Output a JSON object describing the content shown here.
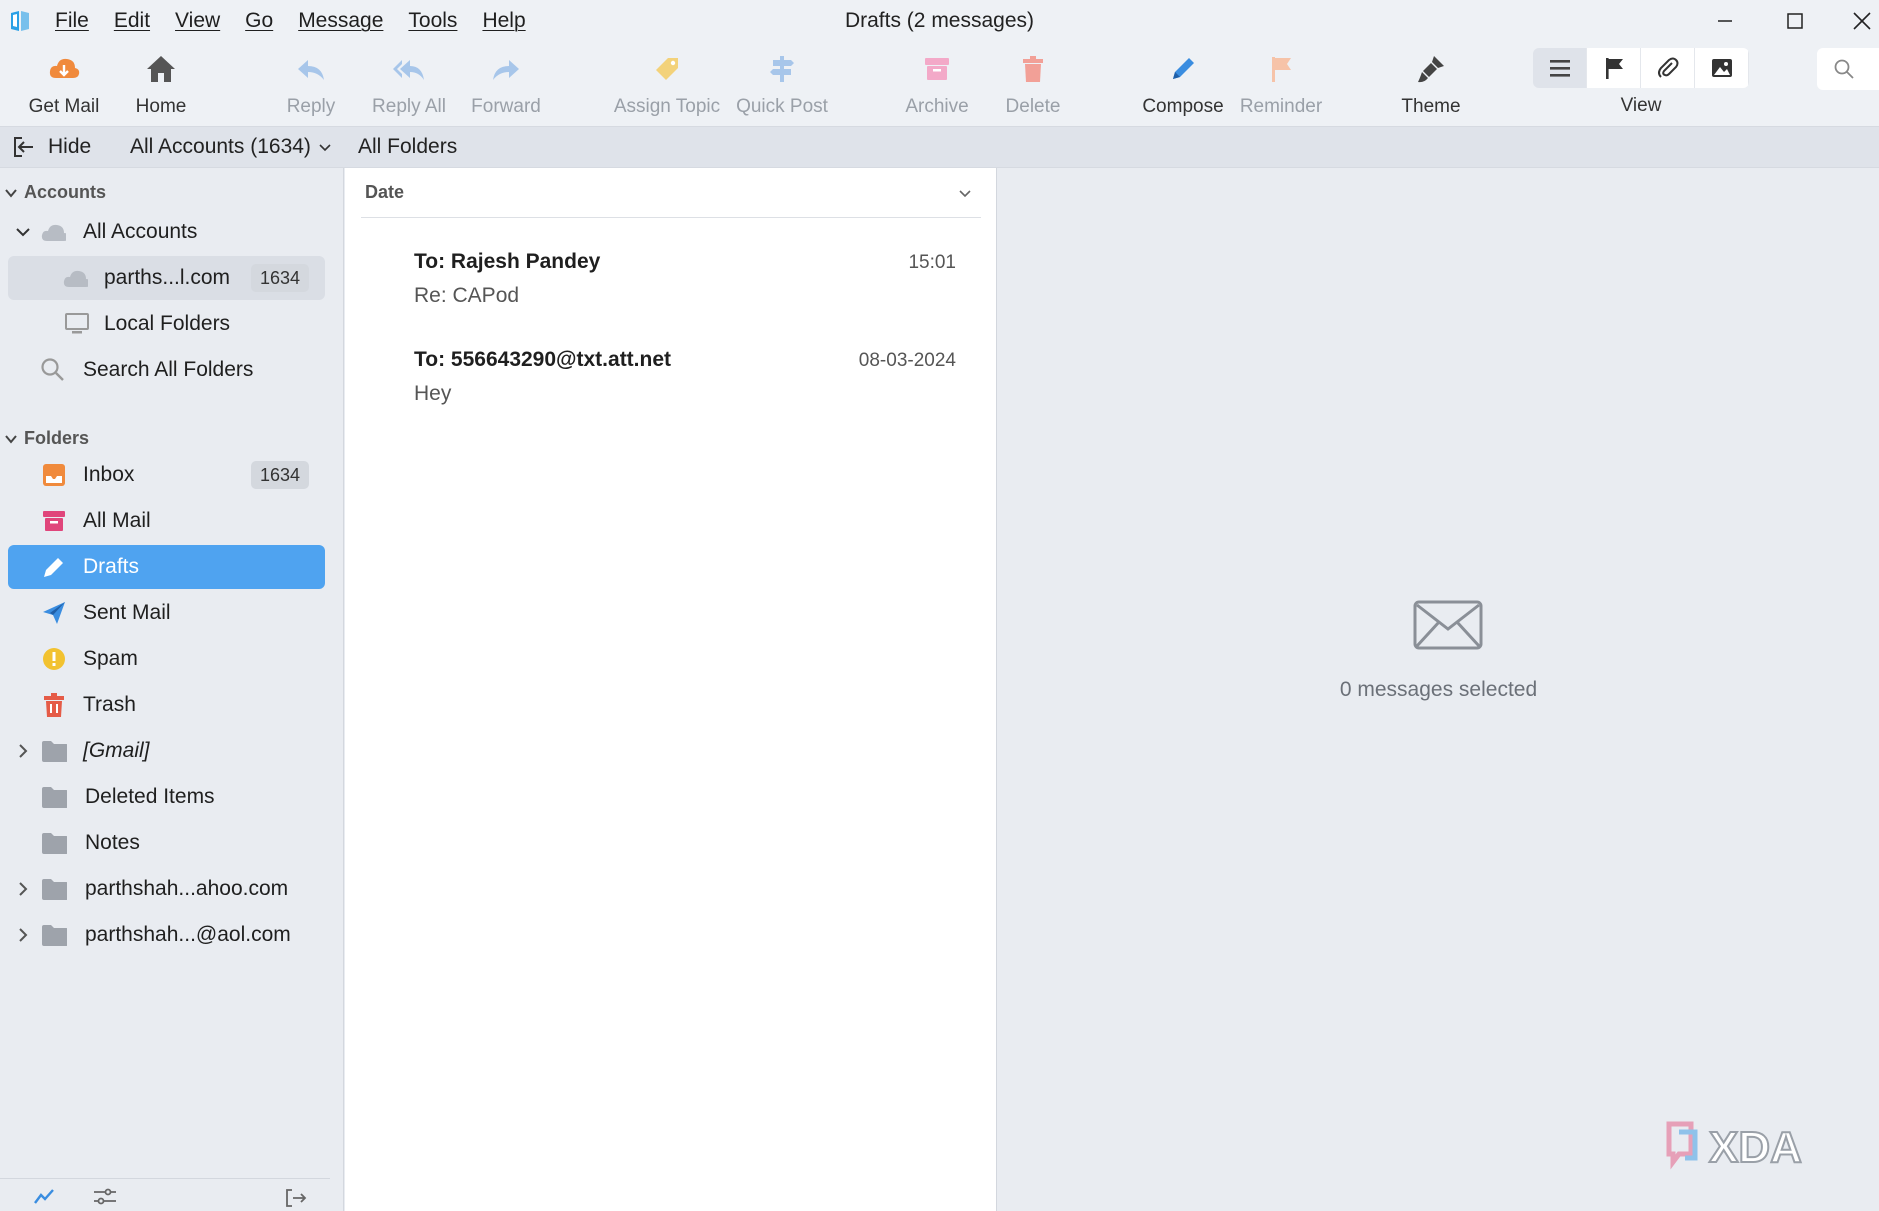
{
  "window": {
    "title": "Drafts (2 messages)"
  },
  "menu": [
    "File",
    "Edit",
    "View",
    "Go",
    "Message",
    "Tools",
    "Help"
  ],
  "toolbar": {
    "get_mail": "Get Mail",
    "home": "Home",
    "reply": "Reply",
    "reply_all": "Reply All",
    "forward": "Forward",
    "assign_topic": "Assign Topic",
    "quick_post": "Quick Post",
    "archive": "Archive",
    "delete": "Delete",
    "compose": "Compose",
    "reminder": "Reminder",
    "theme": "Theme",
    "view": "View"
  },
  "folderbar": {
    "hide": "Hide",
    "account_selector": "All Accounts (1634)",
    "scope": "All Folders"
  },
  "sidebar": {
    "accounts_header": "Accounts",
    "all_accounts": "All Accounts",
    "account_item": {
      "label": "parths...l.com",
      "count": "1634"
    },
    "local_folders": "Local Folders",
    "search_all": "Search All Folders",
    "folders_header": "Folders",
    "folders": [
      {
        "label": "Inbox",
        "count": "1634"
      },
      {
        "label": "All Mail"
      },
      {
        "label": "Drafts"
      },
      {
        "label": "Sent Mail"
      },
      {
        "label": "Spam"
      },
      {
        "label": "Trash"
      },
      {
        "label": "[Gmail]"
      },
      {
        "label": "Deleted Items"
      },
      {
        "label": "Notes"
      },
      {
        "label": "parthshah...ahoo.com"
      },
      {
        "label": "parthshah...@aol.com"
      }
    ]
  },
  "message_list": {
    "sort_column": "Date",
    "messages": [
      {
        "to": "To: Rajesh Pandey",
        "subject": "Re: CAPod",
        "date": "15:01"
      },
      {
        "to": "To: 556643290@txt.att.net",
        "subject": "Hey",
        "date": "08-03-2024"
      }
    ]
  },
  "preview": {
    "empty_text": "0 messages selected"
  },
  "watermark": "XDA",
  "colors": {
    "accent": "#4fa3f0",
    "chrome": "#eef1f5",
    "pane": "#e9ecf1"
  }
}
